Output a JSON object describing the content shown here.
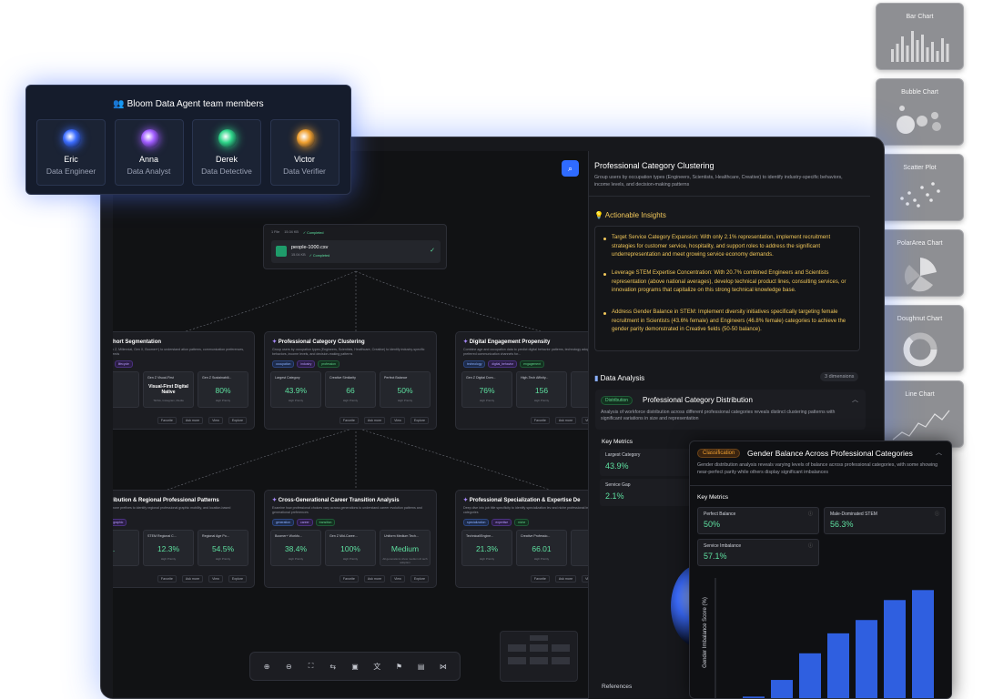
{
  "team": {
    "title": "Bloom Data Agent team members",
    "members": [
      {
        "name": "Eric",
        "role": "Data Engineer",
        "color": "#3b6cff"
      },
      {
        "name": "Anna",
        "role": "Data Analyst",
        "color": "#a05cff"
      },
      {
        "name": "Derek",
        "role": "Data Detective",
        "color": "#2fd68a"
      },
      {
        "name": "Victor",
        "role": "Data Verifier",
        "color": "#f0a030"
      }
    ]
  },
  "chart_types": [
    "Bar Chart",
    "Bubble Chart",
    "Scatter Plot",
    "PolarArea Chart",
    "Doughnut Chart",
    "Line Chart"
  ],
  "file_node": {
    "meta": [
      "1 File",
      "15.04 KB",
      "✓ Completed"
    ],
    "filename": "people-1000.csv",
    "size": "15.04 KB",
    "status": "✓ Completed"
  },
  "nodes": [
    {
      "title": "nal Cohort Segmentation",
      "desc": "generation (Gen Z, Millennial, Gen X, Boomer+) to understand ation patterns, communication preferences, and life stage needs",
      "tags": [
        "ion_cohort",
        "lifecycle"
      ],
      "metrics": [
        {
          "label": "",
          "value": "",
          "sub": ""
        },
        {
          "label": "Gen Z Visual-First",
          "value": "Visual-First Digital Native",
          "sub": "TikTok, Instagram, Media"
        },
        {
          "label": "Gen Z Sustainabili...",
          "value": "80%",
          "sub": "High Priority"
        }
      ]
    },
    {
      "title": "Professional Category Clustering",
      "desc": "Group users by occupation types (Engineers, Scientists, Healthcare, Creative) to identify industry-specific behaviors, income levels, and decision-making patterns",
      "tags": [
        "occupation",
        "industry",
        "profession"
      ],
      "metrics": [
        {
          "label": "Largest Category",
          "value": "43.9%",
          "sub": "High Priority"
        },
        {
          "label": "Creative Similarity",
          "value": "66",
          "sub": "High Priority"
        },
        {
          "label": "Perfect Balance",
          "value": "50%",
          "sub": "High Priority"
        }
      ]
    },
    {
      "title": "Digital Engagement Propensity",
      "desc": "Combine age and occupation data to predict digital behavior patterns, technology adoption willingness, and preferred communication channels for...",
      "tags": [
        "technology",
        "digital_behavior",
        "engagement"
      ],
      "metrics": [
        {
          "label": "Gen Z Digital Dom...",
          "value": "76%",
          "sub": "High Priority"
        },
        {
          "label": "High-Tech Affinity...",
          "value": "156",
          "sub": "High Priority"
        },
        {
          "label": "",
          "value": "",
          "sub": ""
        }
      ]
    },
    {
      "title": "c Distribution & Regional Professional Patterns",
      "desc": "patterns from phone prefixes to identify regional professional graphic mobility, and location-based preferences.",
      "tags": [
        "ion",
        "geographic"
      ],
      "metrics": [
        {
          "label": "",
          "value": ".",
          "sub": ""
        },
        {
          "label": "STEM Regional C...",
          "value": "12.3%",
          "sub": "High Priority"
        },
        {
          "label": "Regional Age Po...",
          "value": "54.5%",
          "sub": "High Priority"
        }
      ]
    },
    {
      "title": "Cross-Generational Career Transition Analysis",
      "desc": "Examine how professional choices vary across generations to understand career evolution patterns and generational preferences",
      "tags": [
        "generation",
        "career",
        "transition"
      ],
      "metrics": [
        {
          "label": "Boomer+ Workfo...",
          "value": "38.4%",
          "sub": "High Priority"
        },
        {
          "label": "Gen Z Mid-Caree...",
          "value": "100%",
          "sub": "High Priority"
        },
        {
          "label": "Uniform Medium Tech...",
          "value": "Medium",
          "sub": "All generations show medium AI tech adoption"
        }
      ]
    },
    {
      "title": "Professional Specialization & Expertise De",
      "desc": "Deep dive into job title specificity to identify specialization lev and niche professional interests within categories",
      "tags": [
        "specialization",
        "expertise",
        "niche"
      ],
      "metrics": [
        {
          "label": "Technical/Engine...",
          "value": "21.3%",
          "sub": "High Priority"
        },
        {
          "label": "Creative Professio...",
          "value": "66.01",
          "sub": "High Priority"
        },
        {
          "label": "",
          "value": "",
          "sub": ""
        }
      ]
    }
  ],
  "node_actions": [
    "Favorite",
    "Ask more",
    "View",
    "Explore"
  ],
  "panel": {
    "title": "Professional Category Clustering",
    "desc": "Group users by occupation types (Engineers, Scientists, Healthcare, Creative) to identify industry-specific behaviors, income levels, and decision-making patterns",
    "insights_title": "Actionable Insights",
    "insights": [
      "Target Service Category Expansion: With only 2.1% representation, implement recruitment strategies for customer service, hospitality, and support roles to address the significant underrepresentation and meet growing service economy demands.",
      "Leverage STEM Expertise Concentration: With 20.7% combined Engineers and Scientists representation (above national averages), develop technical product lines, consulting services, or innovation programs that capitalize on this strong technical knowledge base.",
      "Address Gender Balance in STEM: Implement diversity initiatives specifically targeting female recruitment in Scientists (43.6% female) and Engineers (46.8% female) categories to achieve the gender parity demonstrated in Creative fields (50-50 balance)."
    ],
    "analysis_title": "Data Analysis",
    "dimensions": "3 dimensions",
    "dist_badge": "Distribution",
    "dist_title": "Professional Category Distribution",
    "dist_desc": "Analysis of workforce distribution across different professional categories reveals distinct clustering patterns with significant variations in size and representation",
    "key_metrics": "Key Metrics",
    "metrics": [
      {
        "label": "Largest Category",
        "value": "43.9%"
      },
      {
        "label": "Service Gap",
        "value": "2.1%"
      }
    ],
    "references": "References"
  },
  "gender": {
    "badge": "Classification",
    "title": "Gender Balance Across Professional Categories",
    "desc": "Gender distribution analysis reveals varying levels of balance across professional categories, with some showing near-perfect parity while others display significant imbalances",
    "key_metrics": "Key Metrics",
    "metrics": [
      {
        "label": "Perfect Balance",
        "value": "50%"
      },
      {
        "label": "Male-Dominated STEM",
        "value": "56.3%"
      },
      {
        "label": "Service Imbalance",
        "value": "57.1%"
      }
    ]
  },
  "chart_data": {
    "type": "bar",
    "ylabel": "Gender Imbalance Score (%)",
    "values": [
      2,
      12,
      28,
      40,
      48,
      60,
      66
    ],
    "color": "#2f5fe0"
  },
  "toolbar_icons": [
    "zoom-in-icon",
    "zoom-out-icon",
    "fit-view-icon",
    "swap-icon",
    "layout-icon",
    "translate-icon",
    "bookmark-icon",
    "document-icon",
    "share-icon"
  ],
  "colors": {
    "accent": "#2f6bff",
    "positive": "#5ee0a0",
    "insight": "#f1c75a"
  }
}
